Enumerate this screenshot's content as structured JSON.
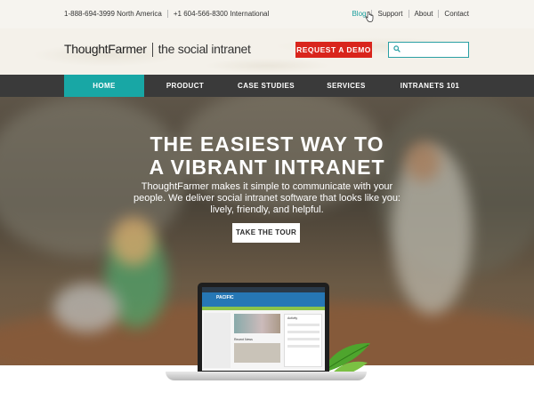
{
  "topbar": {
    "phone_na": "1-888-694-3999 North America",
    "phone_intl": "+1 604-566-8300 International",
    "links": [
      "Blog",
      "Support",
      "About",
      "Contact"
    ]
  },
  "header": {
    "brand": "ThoughtFarmer",
    "tagline": "the social intranet",
    "demo_label": "REQUEST A DEMO",
    "search_placeholder": ""
  },
  "nav": {
    "items": [
      "HOME",
      "PRODUCT",
      "CASE STUDIES",
      "SERVICES",
      "INTRANETS 101"
    ],
    "active": "HOME"
  },
  "hero": {
    "title_line1": "THE EASIEST WAY TO",
    "title_line2": "A VIBRANT INTRANET",
    "subtitle": "ThoughtFarmer makes it simple to communicate with your people. We deliver social intranet software that looks like you: lively, friendly, and helpful.",
    "cta_label": "TAKE THE TOUR"
  },
  "screen": {
    "company": "PACIFIC",
    "activity_label": "Activity",
    "recent_label": "Recent News"
  },
  "colors": {
    "accent_teal": "#18a7a5",
    "demo_red": "#d9251c",
    "nav_dark": "#3a3a3a"
  }
}
